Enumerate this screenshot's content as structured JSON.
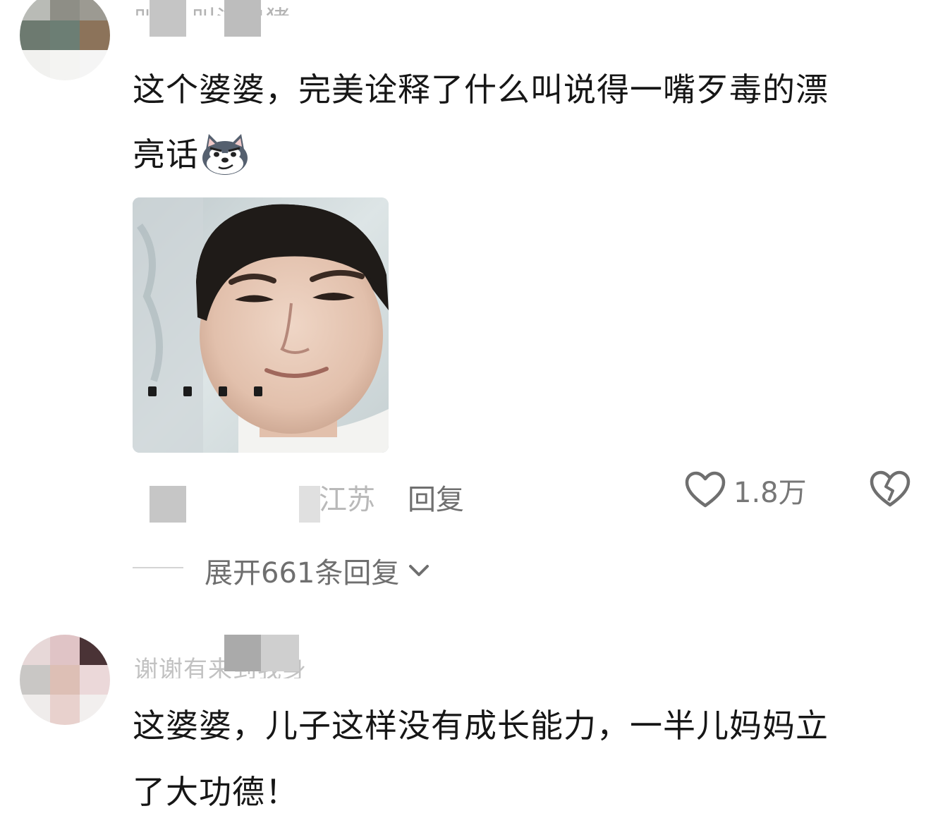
{
  "comments": [
    {
      "username": "叫机 叫流浪猪",
      "text_line1": "这个婆婆，完美诠释了什么叫说得一嘴歹毒的漂",
      "text_line2": "亮话",
      "emoji": "husky-smirk-emoji",
      "image": "man-face-meme-sticker",
      "meta": {
        "location": "江苏",
        "reply_label": "回复",
        "like_count": "1.8万",
        "like_icon": "heart-outline-icon",
        "dislike_icon": "broken-heart-icon"
      },
      "expand_replies_label": "展开661条回复",
      "expand_icon": "chevron-down-icon"
    },
    {
      "username": "谢谢有来到我身",
      "text_line1": "这婆婆，儿子这样没有成长能力，一半儿妈妈立",
      "text_line2": "了大功德！"
    }
  ],
  "colors": {
    "text": "#161616",
    "muted": "#8a8a8a",
    "username": "#b3b3b3",
    "icon": "#6f6f6f"
  }
}
